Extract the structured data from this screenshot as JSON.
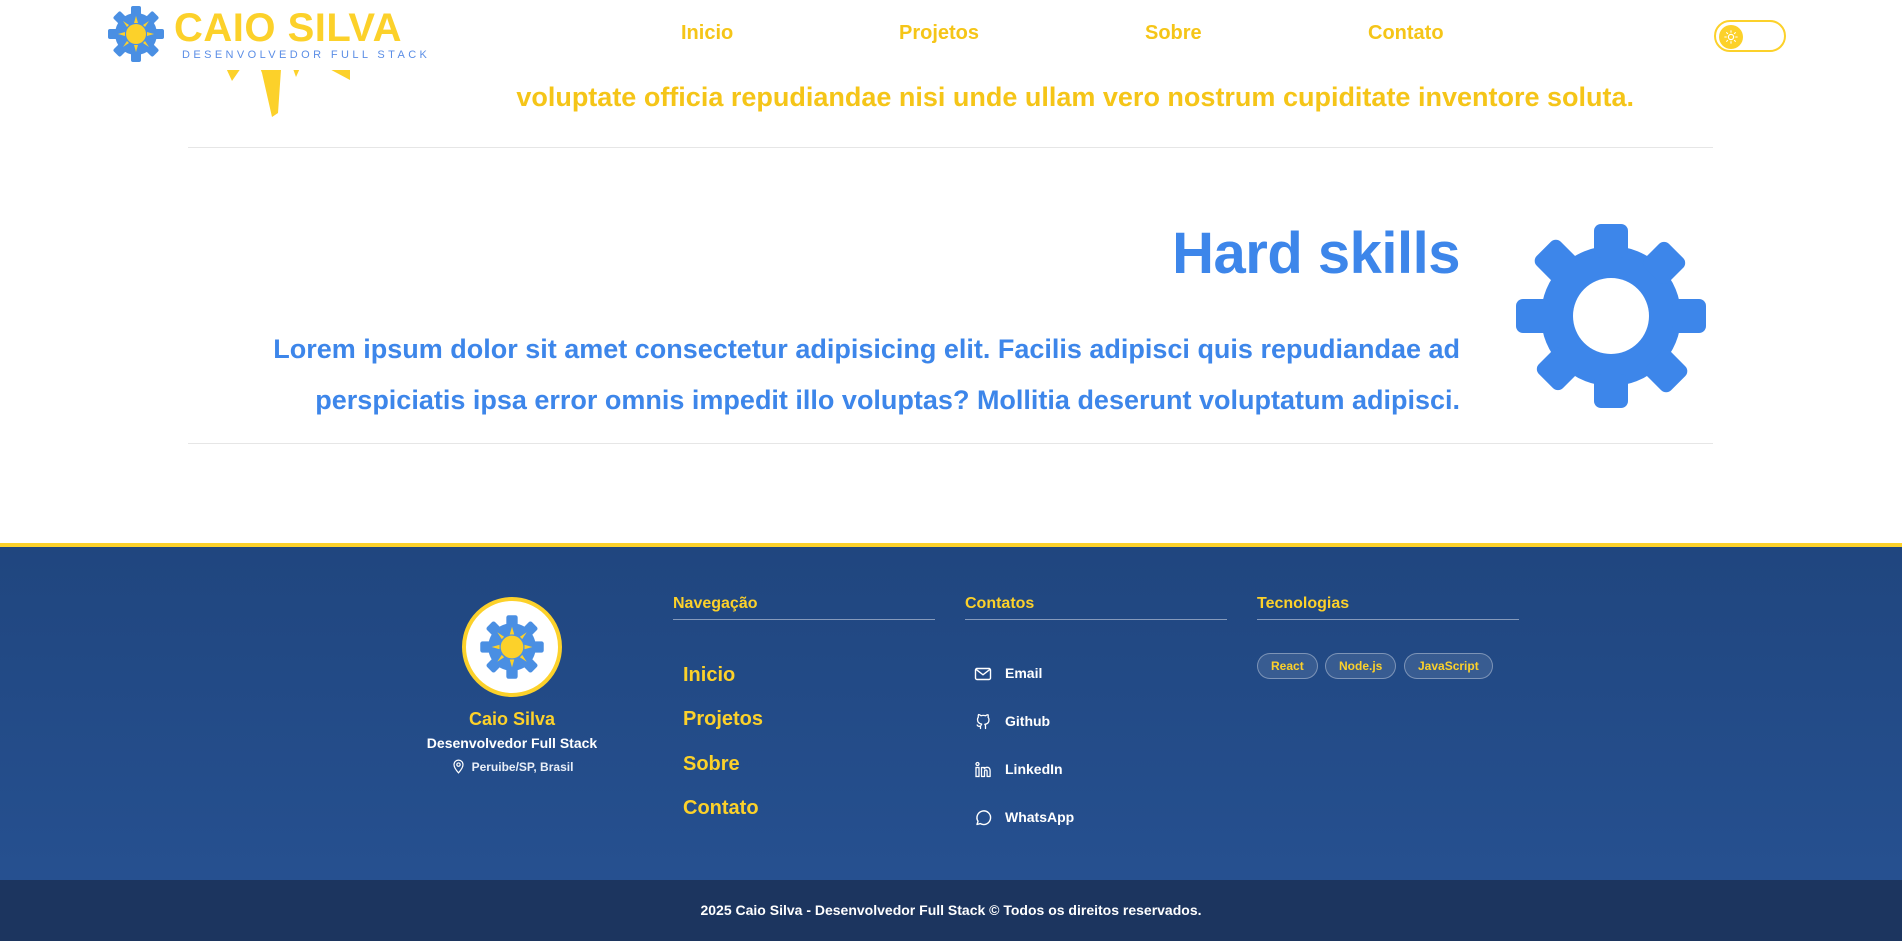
{
  "header": {
    "logo_name": "CAIO SILVA",
    "logo_tagline": "DESENVOLVEDOR FULL STACK",
    "nav": [
      "Inicio",
      "Projetos",
      "Sobre",
      "Contato"
    ]
  },
  "section_prev": {
    "text": "voluptate officia repudiandae nisi unde ullam vero nostrum cupiditate inventore soluta."
  },
  "hard_skills": {
    "title": "Hard skills",
    "line1": "Lorem ipsum dolor sit amet consectetur adipisicing elit. Facilis adipisci quis repudiandae ad",
    "line2": "perspiciatis ipsa error omnis impedit illo voluptas? Mollitia deserunt voluptatum adipisci."
  },
  "footer": {
    "profile": {
      "name": "Caio Silva",
      "role": "Desenvolvedor Full Stack",
      "location": "Peruibe/SP, Brasil"
    },
    "nav_title": "Navegação",
    "nav": [
      "Inicio",
      "Projetos",
      "Sobre",
      "Contato"
    ],
    "contacts_title": "Contatos",
    "contacts": [
      {
        "label": "Email",
        "icon": "mail-icon"
      },
      {
        "label": "Github",
        "icon": "github-icon"
      },
      {
        "label": "LinkedIn",
        "icon": "linkedin-icon"
      },
      {
        "label": "WhatsApp",
        "icon": "whatsapp-icon"
      }
    ],
    "tech_title": "Tecnologias",
    "tech": [
      "React",
      "Node.js",
      "JavaScript"
    ],
    "copyright": "2025 Caio Silva - Desenvolvedor Full Stack © Todos os direitos reservados."
  },
  "colors": {
    "yellow": "#fcd12a",
    "blue": "#3d86ea",
    "footer_bg": "#20467f"
  }
}
